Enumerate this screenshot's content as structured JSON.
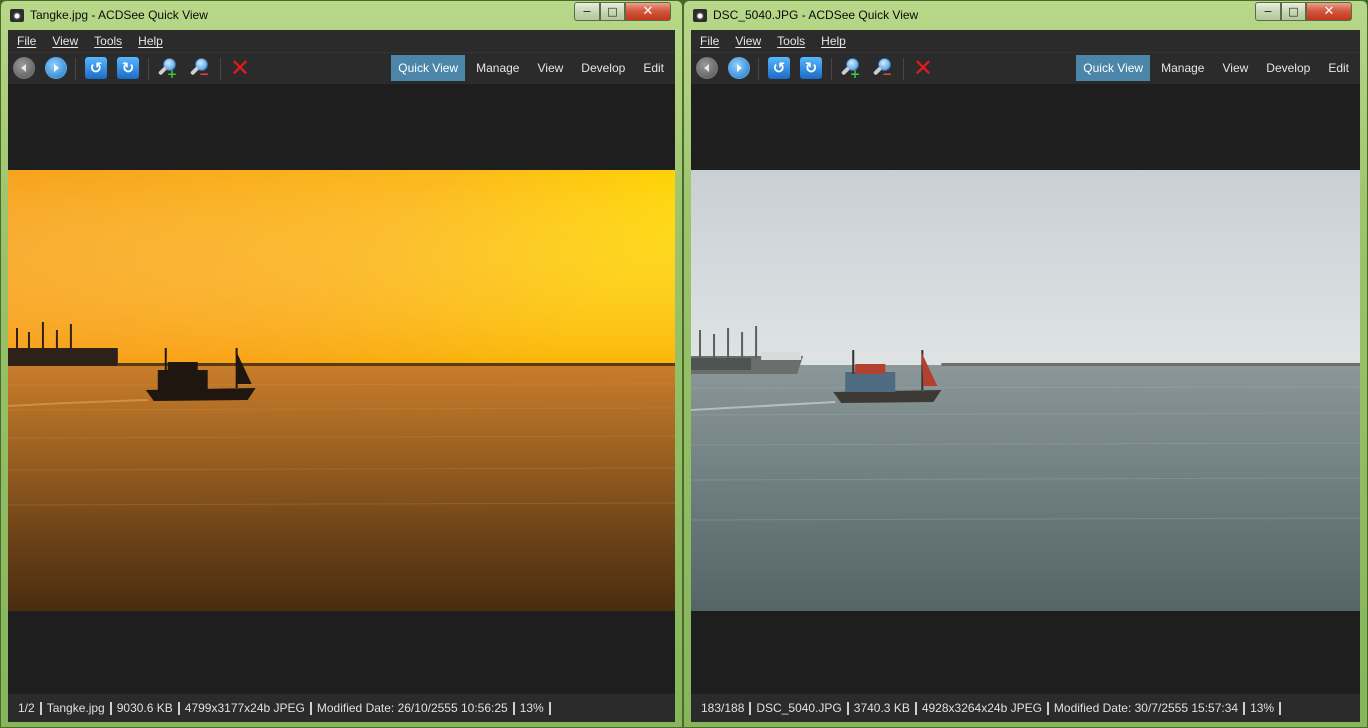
{
  "windows": [
    {
      "title": "Tangke.jpg - ACDSee Quick View",
      "menu": [
        "File",
        "View",
        "Tools",
        "Help"
      ],
      "toolbar_icons": [
        "back-icon",
        "forward-icon",
        "rotate-left-icon",
        "rotate-right-icon",
        "zoom-in-icon",
        "zoom-out-icon",
        "delete-icon"
      ],
      "modes": [
        "Quick View",
        "Manage",
        "View",
        "Develop",
        "Edit"
      ],
      "active_mode": "Quick View",
      "photo_style": "sunset",
      "status": [
        "1/2",
        "Tangke.jpg",
        "9030.6 KB",
        "4799x3177x24b JPEG",
        "Modified Date: 26/10/2555 10:56:25",
        "13%"
      ]
    },
    {
      "title": "DSC_5040.JPG - ACDSee Quick View",
      "menu": [
        "File",
        "View",
        "Tools",
        "Help"
      ],
      "toolbar_icons": [
        "back-icon",
        "forward-icon",
        "rotate-left-icon",
        "rotate-right-icon",
        "zoom-in-icon",
        "zoom-out-icon",
        "delete-icon"
      ],
      "modes": [
        "Quick View",
        "Manage",
        "View",
        "Develop",
        "Edit"
      ],
      "active_mode": "Quick View",
      "photo_style": "overcast",
      "status": [
        "183/188",
        "DSC_5040.JPG",
        "3740.3 KB",
        "4928x3264x24b JPEG",
        "Modified Date: 30/7/2555 15:57:34",
        "13%"
      ]
    }
  ],
  "caption_buttons": {
    "minimize": "−",
    "maximize": "□",
    "close": "✕"
  },
  "colors": {
    "active_tab": "#4b86a8",
    "window_frame": "#9cc46a",
    "background": "#1e1e1e"
  }
}
